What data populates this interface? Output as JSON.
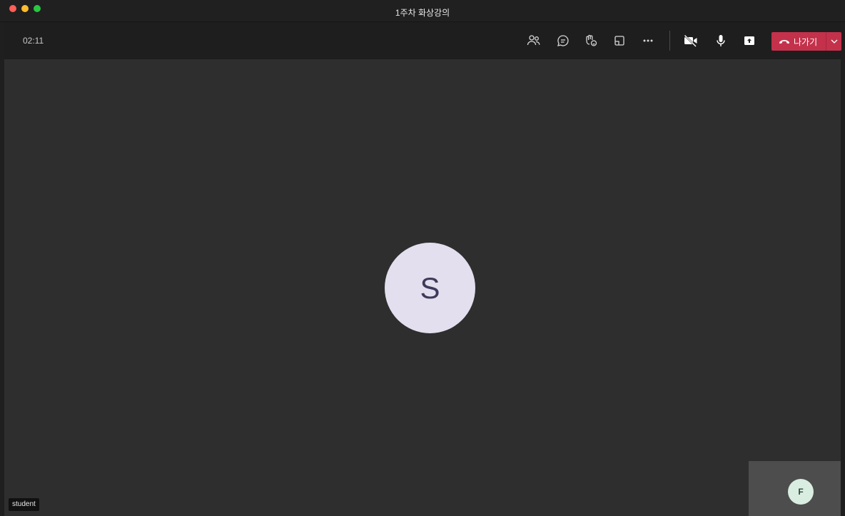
{
  "window": {
    "title": "1주차 화상강의"
  },
  "toolbar": {
    "timer": "02:11",
    "buttons": [
      {
        "name": "participants-icon"
      },
      {
        "name": "chat-icon"
      },
      {
        "name": "raise-hand-icon"
      },
      {
        "name": "rooms-icon"
      },
      {
        "name": "more-options-icon"
      },
      {
        "name": "camera-off-icon"
      },
      {
        "name": "microphone-icon"
      },
      {
        "name": "share-screen-icon"
      }
    ],
    "leave": {
      "label": "나가기",
      "color": "#c4314b"
    }
  },
  "stage": {
    "main_participant": {
      "initial": "S",
      "name": "student"
    },
    "self_view": {
      "initial": "F"
    }
  },
  "colors": {
    "background": "#2e2e2e",
    "toolbar": "#1e1e1e",
    "main_avatar_bg": "#e3dfee",
    "self_avatar_bg": "#d9ede0"
  }
}
